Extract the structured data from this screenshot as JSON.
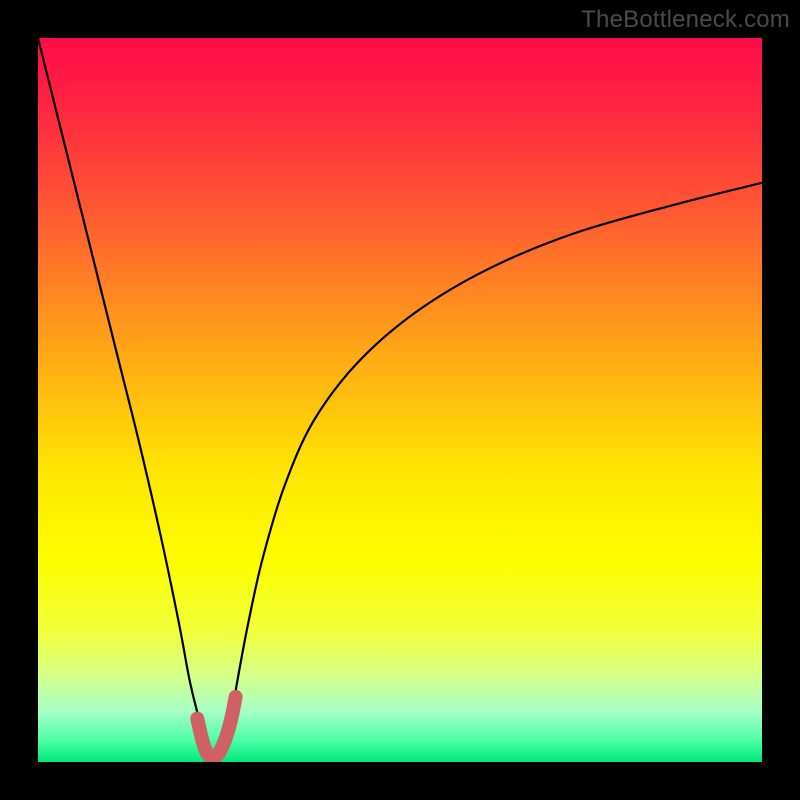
{
  "watermark": "TheBottleneck.com",
  "colors": {
    "frame": "#000000",
    "curve": "#000000",
    "highlight": "#cf6165",
    "gradient_stops": [
      {
        "offset": 0.0,
        "color": "#ff0b49"
      },
      {
        "offset": 0.1,
        "color": "#ff2741"
      },
      {
        "offset": 0.25,
        "color": "#ff5d30"
      },
      {
        "offset": 0.45,
        "color": "#ffae13"
      },
      {
        "offset": 0.6,
        "color": "#ffe602"
      },
      {
        "offset": 0.72,
        "color": "#fdfd00"
      },
      {
        "offset": 0.82,
        "color": "#f1ff3a"
      },
      {
        "offset": 0.88,
        "color": "#d6ff87"
      },
      {
        "offset": 0.93,
        "color": "#a6ffc6"
      },
      {
        "offset": 0.97,
        "color": "#4cffa8"
      },
      {
        "offset": 1.0,
        "color": "#00e979"
      }
    ]
  },
  "chart_data": {
    "type": "line",
    "title": "",
    "xlabel": "",
    "ylabel": "",
    "xlim": [
      0,
      100
    ],
    "ylim": [
      0,
      100
    ],
    "x": [
      0,
      2,
      5,
      8,
      11,
      14,
      17,
      19.5,
      21,
      22.5,
      23.5,
      24.5,
      25.5,
      26.5,
      27.5,
      29,
      31,
      34,
      38,
      44,
      52,
      62,
      74,
      88,
      100
    ],
    "series": [
      {
        "name": "bottleneck-curve",
        "values": [
          100,
          92,
          80,
          68,
          56,
          44,
          31,
          19,
          11,
          5,
          1.5,
          0.3,
          1.5,
          5,
          11,
          19,
          28,
          38,
          47,
          55,
          62,
          68,
          73,
          77,
          80
        ]
      }
    ],
    "highlight_segment": {
      "x": [
        22.0,
        22.7,
        23.3,
        24.0,
        24.7,
        25.3,
        26.0,
        26.7,
        27.3
      ],
      "y": [
        6.0,
        3.0,
        1.3,
        0.7,
        0.9,
        1.8,
        3.5,
        6.0,
        9.0
      ]
    }
  }
}
